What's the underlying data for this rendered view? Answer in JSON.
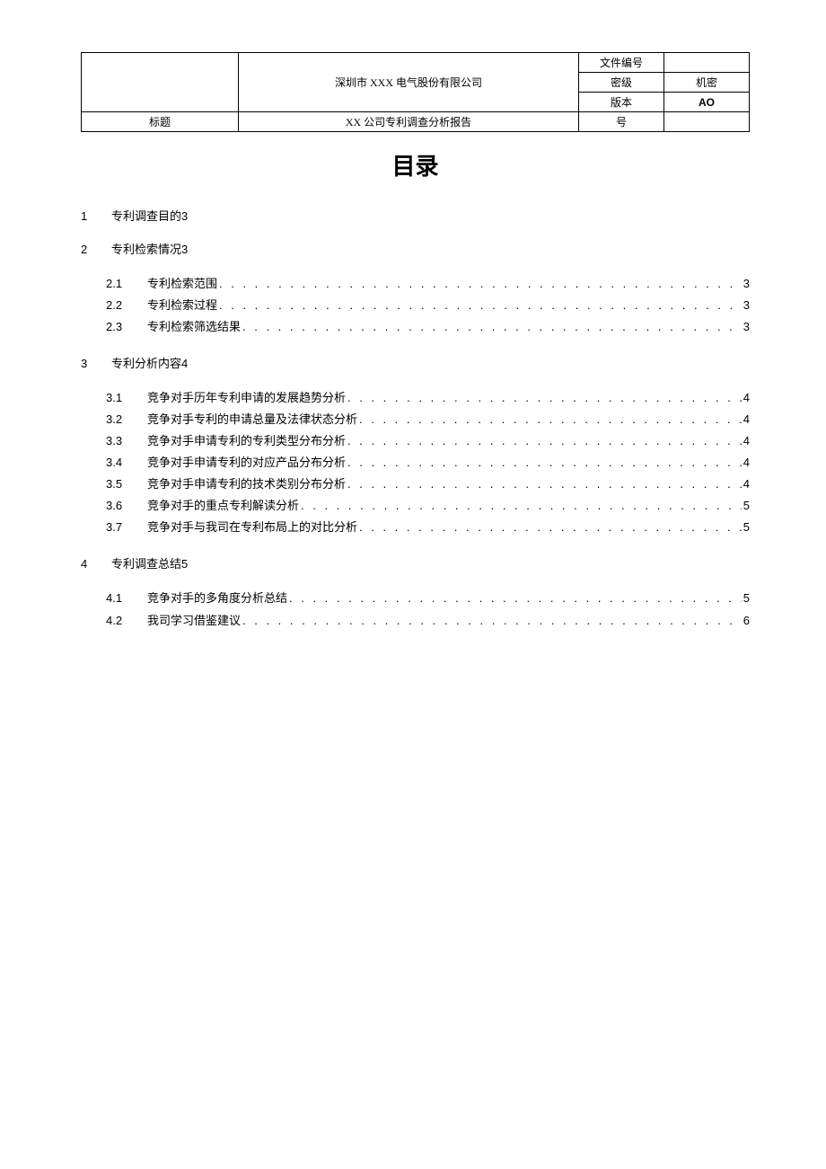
{
  "header": {
    "company": "深圳市 XXX 电气股份有限公司",
    "titleLabel": "标题",
    "titleValue": "XX 公司专利调查分析报告",
    "docNumLabel": "文件编号",
    "docNumValue": "",
    "secrecyLabel": "密级",
    "secrecyValue": "机密",
    "versionLabel": "版本",
    "versionValue": "AO",
    "numberLabel": "号",
    "numberValue": ""
  },
  "tocTitle": "目录",
  "toc": [
    {
      "num": "1",
      "title": "专利调查目的",
      "page": "3",
      "subs": []
    },
    {
      "num": "2",
      "title": "专利检索情况",
      "page": "3",
      "subs": [
        {
          "num": "2.1",
          "title": "专利检索范围",
          "page": "3"
        },
        {
          "num": "2.2",
          "title": "专利检索过程",
          "page": "3"
        },
        {
          "num": "2.3",
          "title": "专利检索筛选结果",
          "page": "3"
        }
      ]
    },
    {
      "num": "3",
      "title": "专利分析内容",
      "page": "4",
      "subs": [
        {
          "num": "3.1",
          "title": "竞争对手历年专利申请的发展趋势分析",
          "page": "4"
        },
        {
          "num": "3.2",
          "title": "竞争对手专利的申请总量及法律状态分析",
          "page": "4"
        },
        {
          "num": "3.3",
          "title": "竞争对手申请专利的专利类型分布分析",
          "page": "4"
        },
        {
          "num": "3.4",
          "title": "竞争对手申请专利的对应产品分布分析",
          "page": "4"
        },
        {
          "num": "3.5",
          "title": "竞争对手申请专利的技术类别分布分析",
          "page": "4"
        },
        {
          "num": "3.6",
          "title": "竞争对手的重点专利解读分析",
          "page": "5"
        },
        {
          "num": "3.7",
          "title": "竞争对手与我司在专利布局上的对比分析",
          "page": "5"
        }
      ]
    },
    {
      "num": "4",
      "title": "专利调查总结",
      "page": "5",
      "subs": [
        {
          "num": "4.1",
          "title": "竞争对手的多角度分析总结",
          "page": "5"
        },
        {
          "num": "4.2",
          "title": "我司学习借鉴建议",
          "page": "6"
        }
      ]
    }
  ]
}
